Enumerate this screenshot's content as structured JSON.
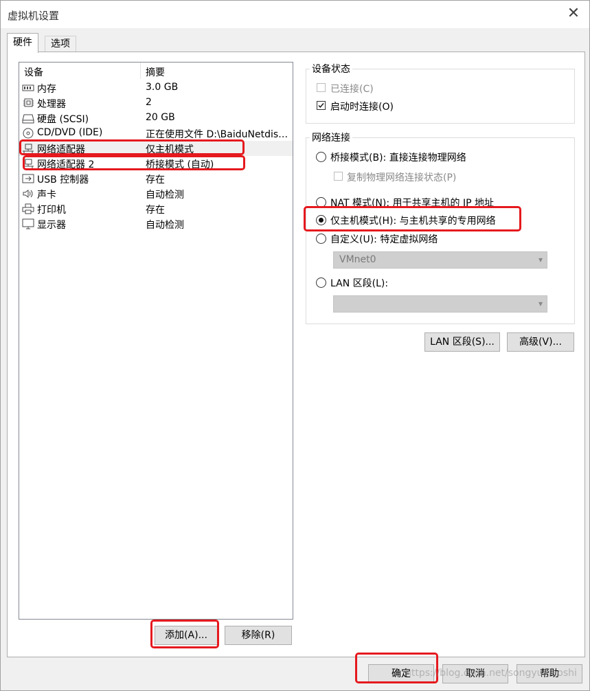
{
  "window": {
    "title": "虚拟机设置",
    "close_glyph": "✕"
  },
  "tabs": [
    {
      "label": "硬件"
    },
    {
      "label": "选项"
    }
  ],
  "device_list": {
    "headers": {
      "device": "设备",
      "summary": "摘要"
    },
    "rows": [
      {
        "icon": "memory-icon",
        "name": "内存",
        "summary": "3.0 GB"
      },
      {
        "icon": "processor-icon",
        "name": "处理器",
        "summary": "2"
      },
      {
        "icon": "hard-disk-icon",
        "name": "硬盘 (SCSI)",
        "summary": "20 GB"
      },
      {
        "icon": "cd-dvd-icon",
        "name": "CD/DVD (IDE)",
        "summary": "正在使用文件 D:\\BaiduNetdis…"
      },
      {
        "icon": "network-adapter-icon",
        "name": "网络适配器",
        "summary": "仅主机模式",
        "selected": true
      },
      {
        "icon": "network-adapter-icon",
        "name": "网络适配器 2",
        "summary": "桥接模式 (自动)"
      },
      {
        "icon": "usb-icon",
        "name": "USB 控制器",
        "summary": "存在"
      },
      {
        "icon": "sound-icon",
        "name": "声卡",
        "summary": "自动检测"
      },
      {
        "icon": "printer-icon",
        "name": "打印机",
        "summary": "存在"
      },
      {
        "icon": "display-icon",
        "name": "显示器",
        "summary": "自动检测"
      }
    ]
  },
  "buttons": {
    "add": "添加(A)...",
    "remove": "移除(R)",
    "ok": "确定",
    "cancel": "取消",
    "help": "帮助",
    "lan_segments": "LAN 区段(S)...",
    "advanced": "高级(V)..."
  },
  "device_status": {
    "title": "设备状态",
    "connected": {
      "label": "已连接(C)",
      "checked": false,
      "enabled": false
    },
    "connect_at_power_on": {
      "label": "启动时连接(O)",
      "checked": true
    }
  },
  "network_connection": {
    "title": "网络连接",
    "bridged": {
      "label": "桥接模式(B): 直接连接物理网络",
      "selected": false
    },
    "replicate_state": {
      "label": "复制物理网络连接状态(P)",
      "checked": false,
      "enabled": false
    },
    "nat": {
      "label": "NAT 模式(N): 用于共享主机的 IP 地址",
      "selected": false
    },
    "host_only": {
      "label": "仅主机模式(H): 与主机共享的专用网络",
      "selected": true
    },
    "custom": {
      "label": "自定义(U): 特定虚拟网络",
      "selected": false,
      "select_value": "VMnet0"
    },
    "lan_segment": {
      "label": "LAN 区段(L):",
      "selected": false,
      "select_value": ""
    }
  },
  "watermark": "https://blog.csdn.net/songyuxiaoshi",
  "colors": {
    "highlight_red": "#e5191e",
    "window_bg": "#f0f0f0"
  }
}
